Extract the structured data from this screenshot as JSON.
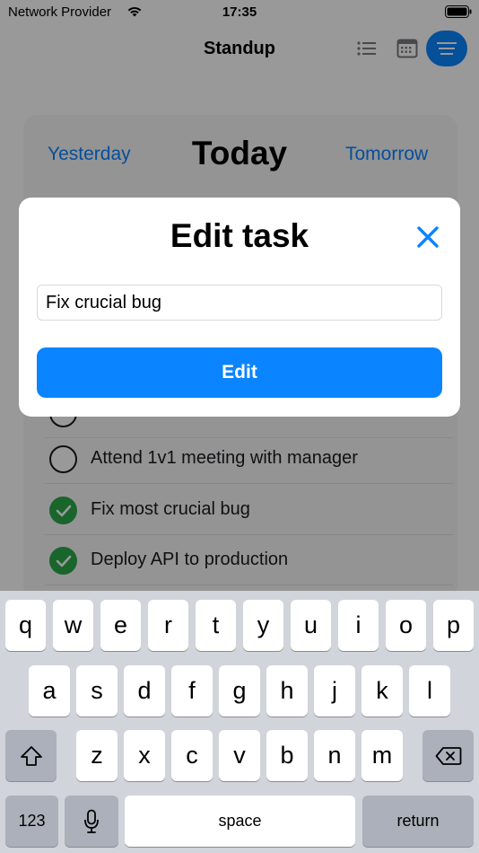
{
  "status_bar": {
    "carrier": "Network Provider",
    "time": "17:35"
  },
  "nav": {
    "title": "Standup"
  },
  "days": {
    "yesterday": "Yesterday",
    "today": "Today",
    "tomorrow": "Tomorrow"
  },
  "tasks": [
    {
      "text": "Attend 1v1 meeting with manager",
      "done": false
    },
    {
      "text": "Fix most crucial bug",
      "done": true
    },
    {
      "text": "Deploy API to production",
      "done": true
    }
  ],
  "modal": {
    "title": "Edit task",
    "input_value": "Fix crucial bug",
    "button_label": "Edit"
  },
  "keyboard": {
    "row1": [
      "q",
      "w",
      "e",
      "r",
      "t",
      "y",
      "u",
      "i",
      "o",
      "p"
    ],
    "row2": [
      "a",
      "s",
      "d",
      "f",
      "g",
      "h",
      "j",
      "k",
      "l"
    ],
    "row3": [
      "z",
      "x",
      "c",
      "v",
      "b",
      "n",
      "m"
    ],
    "numbers_label": "123",
    "space_label": "space",
    "return_label": "return"
  },
  "colors": {
    "accent": "#0a84ff",
    "done": "#2ba84a"
  }
}
